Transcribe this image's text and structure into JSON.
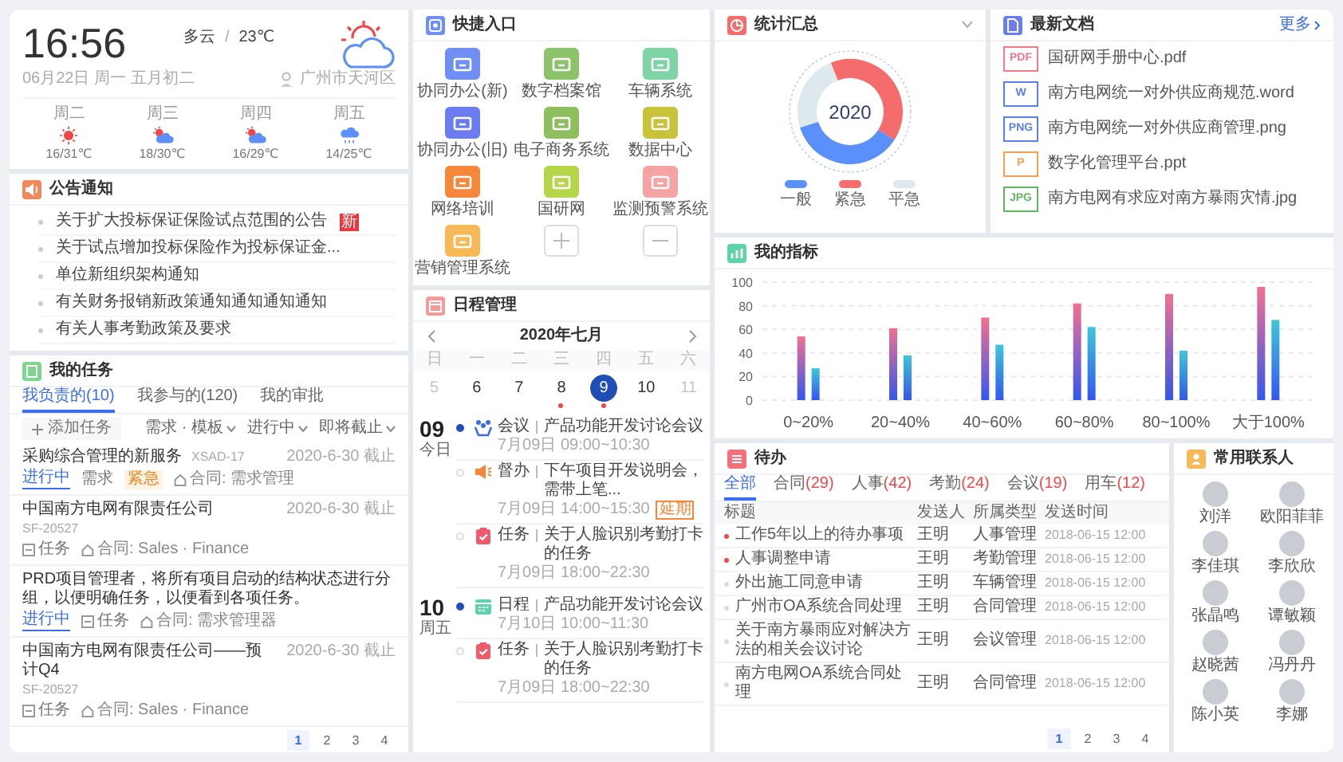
{
  "weather": {
    "time": "16:56",
    "condition": "多云",
    "separator": "/",
    "temperature": "23℃",
    "date": "06月22日 周一 五月初二",
    "location": "广州市天河区",
    "forecast": [
      {
        "day": "周二",
        "kind": "sunny",
        "temp": "16/31℃"
      },
      {
        "day": "周三",
        "kind": "partly_cloudy",
        "temp": "18/30℃"
      },
      {
        "day": "周四",
        "kind": "partly_cloudy",
        "temp": "16/29℃"
      },
      {
        "day": "周五",
        "kind": "rain",
        "temp": "14/25℃"
      }
    ]
  },
  "notices": {
    "title": "公告通知",
    "items": [
      {
        "text": "关于扩大投标保证保险试点范围的公告",
        "badge": "新"
      },
      {
        "text": "关于试点增加投标保险作为投标保证金..."
      },
      {
        "text": "单位新组织架构通知"
      },
      {
        "text": "有关财务报销新政策通知通知通知通知"
      },
      {
        "text": "有关人事考勤政策及要求"
      }
    ]
  },
  "tasks": {
    "title": "我的任务",
    "tabs": [
      {
        "label": "我负责的(10)",
        "selected": true
      },
      {
        "label": "我参与的(120)",
        "selected": false
      },
      {
        "label": "我的审批",
        "selected": false
      }
    ],
    "add_label": "添加任务",
    "filters": [
      "需求 · 模板",
      "进行中",
      "即将截止"
    ],
    "items": [
      {
        "title": "采购综合管理的新服务",
        "code": "XSAD-17",
        "due": "2020-6-30 截止",
        "tags": [
          {
            "label": "进行中",
            "kind": "status"
          },
          {
            "label": "需求",
            "kind": "plain"
          },
          {
            "label": "紧急",
            "kind": "priority"
          }
        ],
        "project": "合同: 需求管理"
      },
      {
        "title": "中国南方电网有限责任公司",
        "code": "SF-20527",
        "due": "2020-6-30 截止",
        "tags": [
          {
            "label": "任务",
            "kind": "type"
          }
        ],
        "project": "合同: Sales · Finance"
      },
      {
        "title": "PRD项目管理者，将所有项目启动的结构状态进行分组，以便明确任务，以便看到各项任务。",
        "tags": [
          {
            "label": "进行中",
            "kind": "status"
          },
          {
            "label": "任务",
            "kind": "type"
          }
        ],
        "project": "合同: 需求管理器"
      },
      {
        "title": "中国南方电网有限责任公司——预计Q4",
        "code": "SF-20527",
        "due": "2020-6-30 截止",
        "tags": [
          {
            "label": "任务",
            "kind": "type"
          }
        ],
        "project": "合同: Sales · Finance"
      }
    ],
    "pages": [
      {
        "label": "1",
        "selected": true
      },
      {
        "label": "2",
        "selected": false
      },
      {
        "label": "3",
        "selected": false
      },
      {
        "label": "4",
        "selected": false
      }
    ]
  },
  "quick_entry": {
    "title": "快捷入口",
    "items": [
      {
        "kind": "app",
        "label": "协同办公(新)",
        "color": "#6f8ff5"
      },
      {
        "kind": "app",
        "label": "数字档案馆",
        "color": "#8cc36a"
      },
      {
        "kind": "app",
        "label": "车辆系统",
        "color": "#7fd4a6"
      },
      {
        "kind": "app",
        "label": "协同办公(旧)",
        "color": "#6b7cf0"
      },
      {
        "kind": "app",
        "label": "电子商务系统",
        "color": "#8dbf5e"
      },
      {
        "kind": "app",
        "label": "数据中心",
        "color": "#c9c33a"
      },
      {
        "kind": "app",
        "label": "网络培训",
        "color": "#f5873a"
      },
      {
        "kind": "app",
        "label": "国研网",
        "color": "#b6d64a"
      },
      {
        "kind": "app",
        "label": "监测预警系统",
        "color": "#f5a3a3"
      },
      {
        "kind": "app",
        "label": "营销管理系统",
        "color": "#f7b955"
      },
      {
        "kind": "add"
      },
      {
        "kind": "remove"
      }
    ]
  },
  "schedule": {
    "title": "日程管理",
    "month": "2020年七月",
    "weekdays": [
      "日",
      "一",
      "二",
      "三",
      "四",
      "五",
      "六"
    ],
    "days": [
      {
        "day": "5",
        "muted": true,
        "selected": false,
        "has_event": false
      },
      {
        "day": "6",
        "muted": false,
        "selected": false,
        "has_event": false
      },
      {
        "day": "7",
        "muted": false,
        "selected": false,
        "has_event": false
      },
      {
        "day": "8",
        "muted": false,
        "selected": false,
        "has_event": true
      },
      {
        "day": "9",
        "muted": false,
        "selected": true,
        "has_event": true
      },
      {
        "day": "10",
        "muted": false,
        "selected": false,
        "has_event": false
      },
      {
        "day": "11",
        "muted": true,
        "selected": false,
        "has_event": false
      }
    ],
    "groups": [
      {
        "date": "09",
        "caption": "今日",
        "events": [
          {
            "kind": "meeting",
            "type_label": "会议",
            "title": "产品功能开发讨论会议",
            "time": "7月09日 09:00~10:30"
          },
          {
            "kind": "supervise",
            "type_label": "督办",
            "title": "下午项目开发说明会，需带上笔...",
            "time": "7月09日 14:00~15:30",
            "tag": "延期"
          },
          {
            "kind": "task",
            "type_label": "任务",
            "title": "关于人脸识别考勤打卡的任务",
            "time": "7月09日 18:00~22:30"
          }
        ]
      },
      {
        "date": "10",
        "caption": "周五",
        "events": [
          {
            "kind": "schedule",
            "type_label": "日程",
            "title": "产品功能开发讨论会议",
            "time": "7月10日 10:00~11:30"
          },
          {
            "kind": "task",
            "type_label": "任务",
            "title": "关于人脸识别考勤打卡的任务",
            "time": "7月09日 18:00~22:30"
          }
        ]
      }
    ]
  },
  "stats": {
    "title": "统计汇总",
    "center_label": "2020",
    "legend": [
      {
        "label": "一般",
        "color": "#5b8ff9"
      },
      {
        "label": "紧急",
        "color": "#f56c6c"
      },
      {
        "label": "平急",
        "color": "#dde9ec"
      }
    ]
  },
  "documents": {
    "title": "最新文档",
    "more": "更多",
    "items": [
      {
        "badge": "PDF",
        "color": "#f07a8a",
        "name": "国研网手册中心.pdf"
      },
      {
        "badge": "W",
        "color": "#5b7ff0",
        "name": "南方电网统一对外供应商规范.word"
      },
      {
        "badge": "PNG",
        "color": "#5b7ff0",
        "name": "南方电网统一对外供应商管理.png"
      },
      {
        "badge": "P",
        "color": "#f5a050",
        "name": "数字化管理平台.ppt"
      },
      {
        "badge": "JPG",
        "color": "#5fb85f",
        "name": "南方电网有求应对南方暴雨灾情.jpg"
      }
    ]
  },
  "indicators": {
    "title": "我的指标",
    "chart_data": {
      "type": "bar",
      "categories": [
        "0~20%",
        "20~40%",
        "40~60%",
        "60~80%",
        "80~100%",
        "大于100%"
      ],
      "series": [
        {
          "color": "#f3708f",
          "values": [
            54,
            61,
            70,
            82,
            90,
            96
          ]
        },
        {
          "color": "#3ec6d8",
          "values": [
            27,
            38,
            47,
            62,
            42,
            68
          ]
        }
      ],
      "ylim": [
        0,
        100
      ],
      "yticks": [
        0,
        20,
        40,
        60,
        80,
        100
      ],
      "grid": true
    }
  },
  "todo": {
    "title": "待办",
    "tabs": [
      {
        "label": "全部",
        "selected": true
      },
      {
        "label": "合同",
        "count": "(29)",
        "selected": false
      },
      {
        "label": "人事",
        "count": "(42)",
        "selected": false
      },
      {
        "label": "考勤",
        "count": "(24)",
        "selected": false
      },
      {
        "label": "会议",
        "count": "(19)",
        "selected": false
      },
      {
        "label": "用车",
        "count": "(12)",
        "selected": false
      }
    ],
    "columns": [
      "标题",
      "发送人",
      "所属类型",
      "发送时间"
    ],
    "rows": [
      {
        "title": "工作5年以上的待办事项",
        "sender": "王明",
        "category": "人事管理",
        "time": "2018-06-15 12:00",
        "urgent": true
      },
      {
        "title": "人事调整申请",
        "sender": "王明",
        "category": "考勤管理",
        "time": "2018-06-15 12:00",
        "urgent": true
      },
      {
        "title": "外出施工同意申请",
        "sender": "王明",
        "category": "车辆管理",
        "time": "2018-06-15 12:00",
        "urgent": false
      },
      {
        "title": "广州市OA系统合同处理",
        "sender": "王明",
        "category": "合同管理",
        "time": "2018-06-15 12:00",
        "urgent": false
      },
      {
        "title": "关于南方暴雨应对解决方法的相关会议讨论",
        "sender": "王明",
        "category": "会议管理",
        "time": "2018-06-15 12:00",
        "urgent": false
      },
      {
        "title": "南方电网OA系统合同处理",
        "sender": "王明",
        "category": "合同管理",
        "time": "2018-06-15 12:00",
        "urgent": false
      }
    ],
    "pages": [
      {
        "label": "1",
        "selected": true
      },
      {
        "label": "2",
        "selected": false
      },
      {
        "label": "3",
        "selected": false
      },
      {
        "label": "4",
        "selected": false
      }
    ]
  },
  "contacts": {
    "title": "常用联系人",
    "items": [
      {
        "name": "刘洋"
      },
      {
        "name": "欧阳菲菲"
      },
      {
        "name": "李佳琪"
      },
      {
        "name": "李欣欣"
      },
      {
        "name": "张晶鸣"
      },
      {
        "name": "谭敏颖"
      },
      {
        "name": "赵晓茜"
      },
      {
        "name": "冯丹丹"
      },
      {
        "name": "陈小英"
      },
      {
        "name": "李娜"
      }
    ]
  }
}
